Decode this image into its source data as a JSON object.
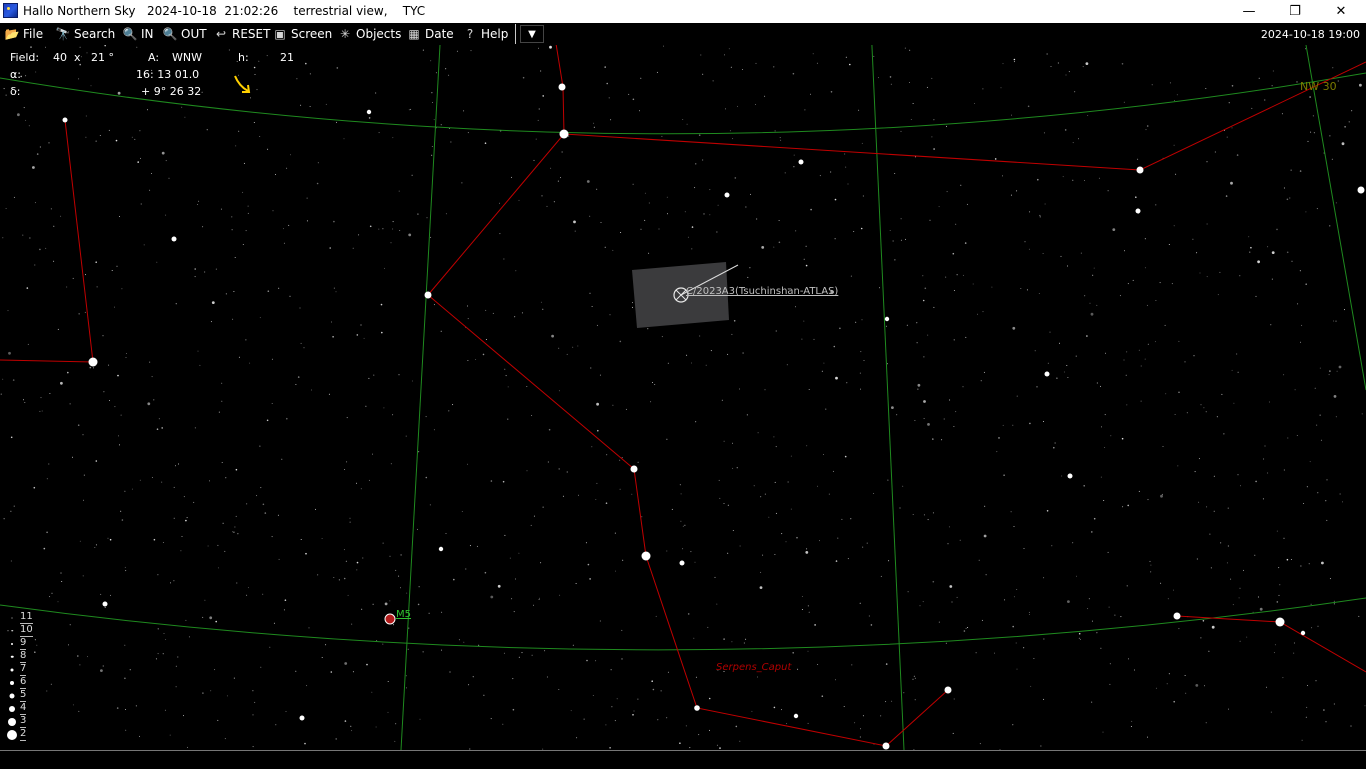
{
  "window": {
    "title": "Hallo Northern Sky   2024-10-18  21:02:26    terrestrial view,    TYC",
    "minimize": "—",
    "maximize": "❐",
    "close": "✕"
  },
  "toolbar": {
    "items": [
      {
        "label": "File",
        "icon": "📂"
      },
      {
        "label": "Search",
        "icon": "🔭"
      },
      {
        "label": "IN",
        "icon": "🔍"
      },
      {
        "label": "OUT",
        "icon": "🔍"
      },
      {
        "label": "RESET",
        "icon": "↩"
      },
      {
        "label": "Screen",
        "icon": "▣"
      },
      {
        "label": "Objects",
        "icon": "✳"
      },
      {
        "label": "Date",
        "icon": "▦"
      },
      {
        "label": "Help",
        "icon": "?"
      }
    ],
    "dropdown": "▼",
    "datetime": "2024-10-18  19:00"
  },
  "info": {
    "field_label": "Field:",
    "field_value": "40  x   21 °",
    "az_label": "A:",
    "az_value": "WNW",
    "alt_label": "h:",
    "alt_value": "21",
    "ra_label": "α:",
    "ra_value": "16: 13 01.0",
    "dec_label": "δ:",
    "dec_value": "+ 9° 26 32"
  },
  "sky": {
    "comet_label": "C/2023A3(Tsuchinshan-ATLAS)",
    "m5_label": "M5",
    "constellation_label": "Serpens_Caput",
    "horizon_label": "NW 30"
  },
  "magnitude_legend": [
    "11",
    "10",
    "9",
    "8",
    "7",
    "6",
    "5",
    "4",
    "3",
    "2"
  ],
  "colors": {
    "constellation_lines": "#c00000",
    "grid_lines": "#1f8a1f",
    "comet_label": "#c0c0c0",
    "pointer_arrow": "#ffd000"
  }
}
